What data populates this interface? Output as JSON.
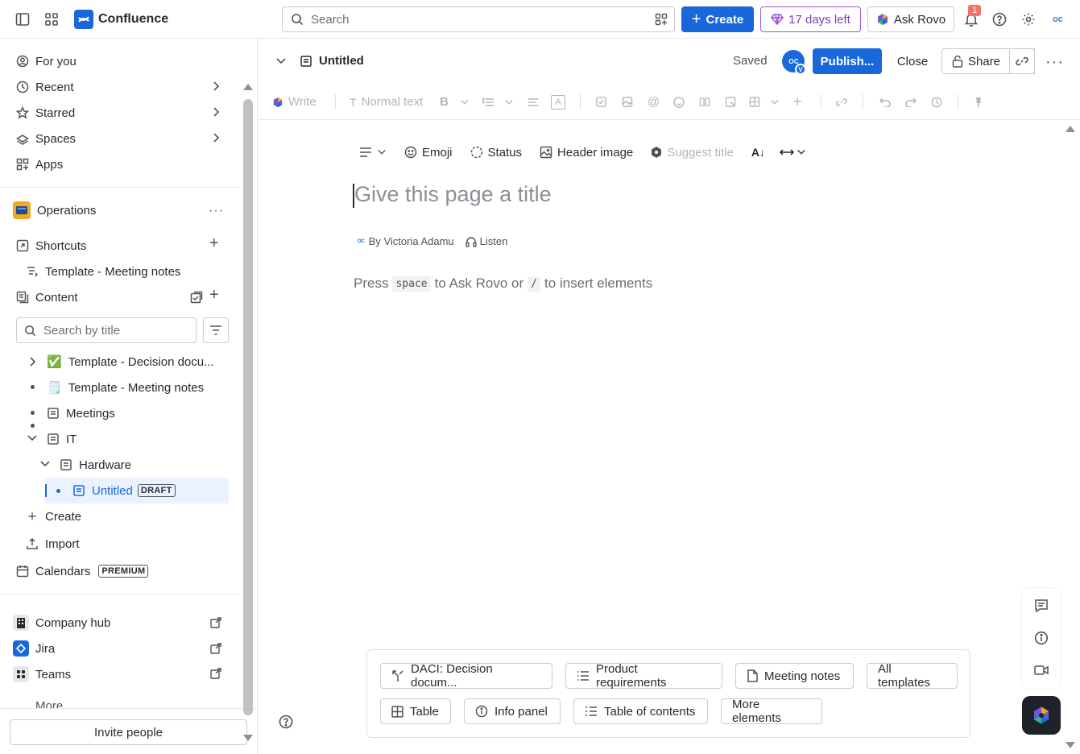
{
  "app": {
    "name": "Confluence"
  },
  "topbar": {
    "search_placeholder": "Search",
    "create_label": "Create",
    "trial_label": "17 days left",
    "rovo_label": "Ask Rovo",
    "notification_count": "1",
    "avatar_initials": "O C"
  },
  "sidebar": {
    "nav": [
      {
        "label": "For you"
      },
      {
        "label": "Recent"
      },
      {
        "label": "Starred"
      },
      {
        "label": "Spaces"
      },
      {
        "label": "Apps"
      }
    ],
    "space_name": "Operations",
    "shortcuts_label": "Shortcuts",
    "shortcut_item": "Template - Meeting notes",
    "content_label": "Content",
    "search_placeholder": "Search by title",
    "tree": [
      {
        "label": "Template - Decision docu...",
        "emoji": "✅"
      },
      {
        "label": "Template - Meeting notes",
        "emoji": "🗒️"
      },
      {
        "label": "Meetings"
      },
      {
        "label": "IT"
      },
      {
        "label": "Hardware"
      },
      {
        "label": "Untitled",
        "badge": "DRAFT"
      }
    ],
    "create_label": "Create",
    "import_label": "Import",
    "calendars_label": "Calendars",
    "calendars_badge": "PREMIUM",
    "links": [
      {
        "label": "Company hub"
      },
      {
        "label": "Jira"
      },
      {
        "label": "Teams"
      }
    ],
    "more_label": "More",
    "invite_label": "Invite people"
  },
  "editor": {
    "page_name": "Untitled",
    "saved_label": "Saved",
    "avatar_initials": "O C",
    "avatar_sub": "V",
    "publish_label": "Publish...",
    "close_label": "Close",
    "share_label": "Share",
    "toolbar": {
      "write_label": "Write",
      "text_style": "Normal text"
    },
    "meta": {
      "emoji_label": "Emoji",
      "status_label": "Status",
      "header_image_label": "Header image",
      "suggest_title_label": "Suggest title"
    },
    "title_placeholder": "Give this page a title",
    "byline": "By Victoria Adamu",
    "listen_label": "Listen",
    "hint_press": "Press",
    "hint_key1": "space",
    "hint_mid": "to Ask Rovo or",
    "hint_key2": "/",
    "hint_end": "to insert elements"
  },
  "templates": {
    "row1": [
      {
        "label": "DACI: Decision docum..."
      },
      {
        "label": "Product requirements"
      },
      {
        "label": "Meeting notes"
      },
      {
        "label": "All templates"
      }
    ],
    "row2": [
      {
        "label": "Table"
      },
      {
        "label": "Info panel"
      },
      {
        "label": "Table of contents"
      },
      {
        "label": "More elements"
      }
    ]
  },
  "colors": {
    "accent": "#1868db",
    "trial": "#7d3ebf",
    "selected_bg": "#e9f2fe"
  }
}
